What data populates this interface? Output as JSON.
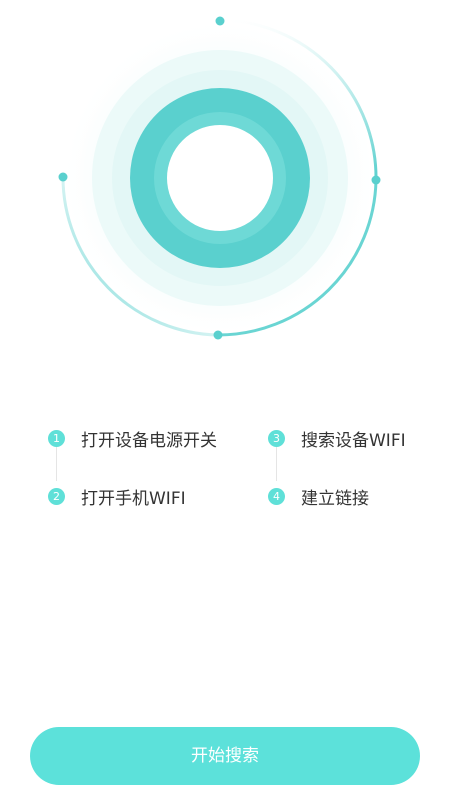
{
  "steps": [
    {
      "number": "1",
      "label": "打开设备电源开关"
    },
    {
      "number": "2",
      "label": "打开手机WIFI"
    },
    {
      "number": "3",
      "label": "搜索设备WIFI"
    },
    {
      "number": "4",
      "label": "建立链接"
    }
  ],
  "start_button": {
    "label": "开始搜索"
  },
  "colors": {
    "accent": "#5ce1da",
    "ring": "#5ad0ce",
    "text": "#333333"
  }
}
